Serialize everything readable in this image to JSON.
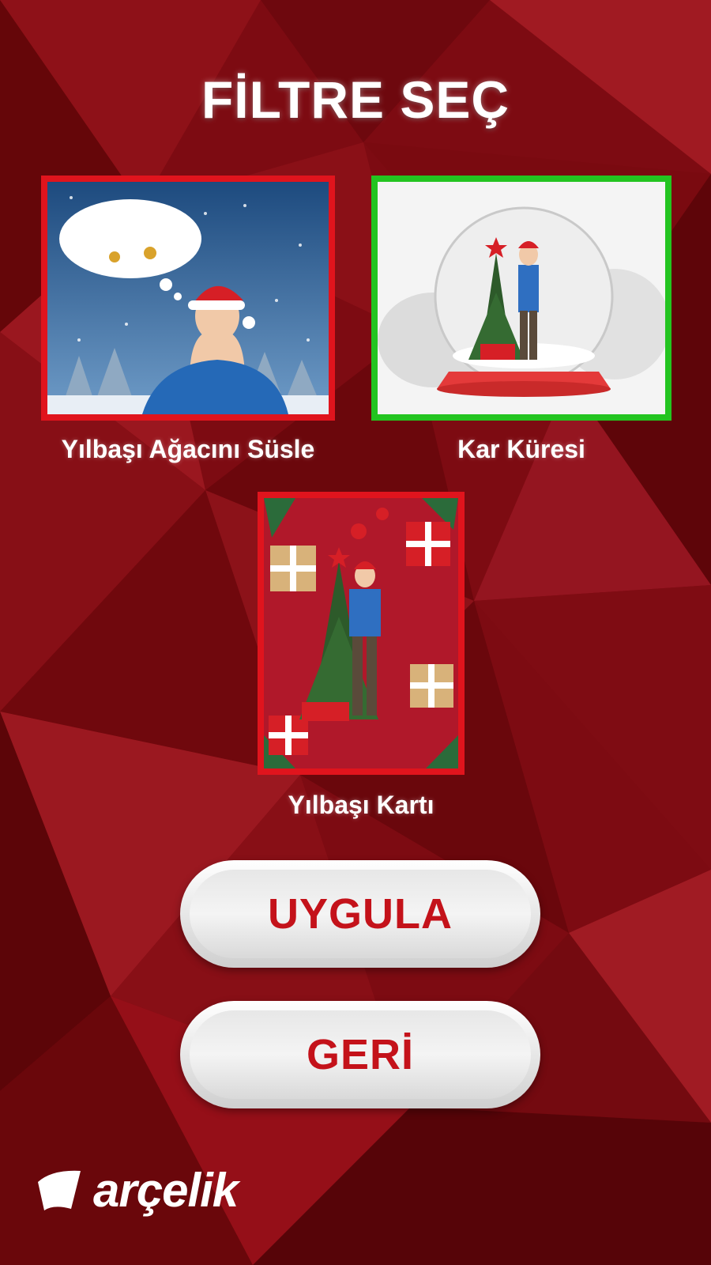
{
  "header": {
    "title": "FİLTRE SEÇ"
  },
  "filters": [
    {
      "label": "Yılbaşı Ağacını Süsle",
      "selected": false
    },
    {
      "label": "Kar Küresi",
      "selected": true
    },
    {
      "label": "Yılbaşı Kartı",
      "selected": false
    }
  ],
  "actions": {
    "apply_label": "UYGULA",
    "back_label": "GERİ"
  },
  "brand": {
    "name": "arçelik"
  },
  "colors": {
    "background": "#7a0a10",
    "selected_border": "#23c420",
    "unselected_border": "#e0141d",
    "button_text": "#c4121a"
  }
}
